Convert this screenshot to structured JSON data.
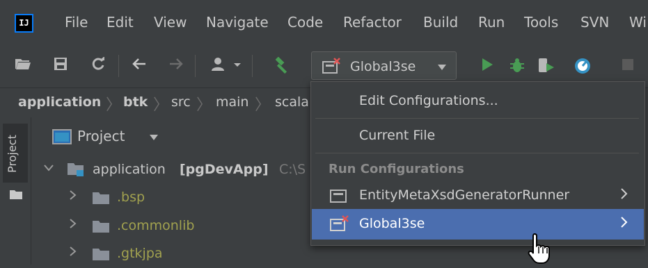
{
  "menubar": {
    "logo": "IJ",
    "items": [
      "File",
      "Edit",
      "View",
      "Navigate",
      "Code",
      "Refactor",
      "Build",
      "Run",
      "Tools",
      "SVN",
      "Wi"
    ]
  },
  "toolbar": {
    "run_config": "Global3se",
    "icons": [
      "open-folder-icon",
      "save-icon",
      "sync-icon",
      "back-icon",
      "forward-icon",
      "user-icon",
      "build-hammer-icon",
      "run-icon",
      "debug-icon",
      "coverage-icon",
      "profile-icon",
      "stop-icon"
    ],
    "colors": {
      "run": "#499c54",
      "build": "#499c54",
      "profile": "#3592c4"
    }
  },
  "breadcrumb": [
    "application",
    "btk",
    "src",
    "main",
    "scala"
  ],
  "side_tool": {
    "label": "Project"
  },
  "project_panel": {
    "title": "Project",
    "root": {
      "name": "application",
      "module": "[pgDevApp]",
      "path": "C:\\S"
    },
    "folders": [
      ".bsp",
      ".commonlib",
      ".gtkjpa"
    ],
    "folder_color": "#a1a14f"
  },
  "dropdown": {
    "edit_configurations": "Edit Configurations...",
    "current_file": "Current File",
    "section_header": "Run Configurations",
    "configs": [
      "EntityMetaXsdGeneratorRunner",
      "Global3se"
    ],
    "selected": "Global3se",
    "selected_color": "#4b6eaf"
  }
}
